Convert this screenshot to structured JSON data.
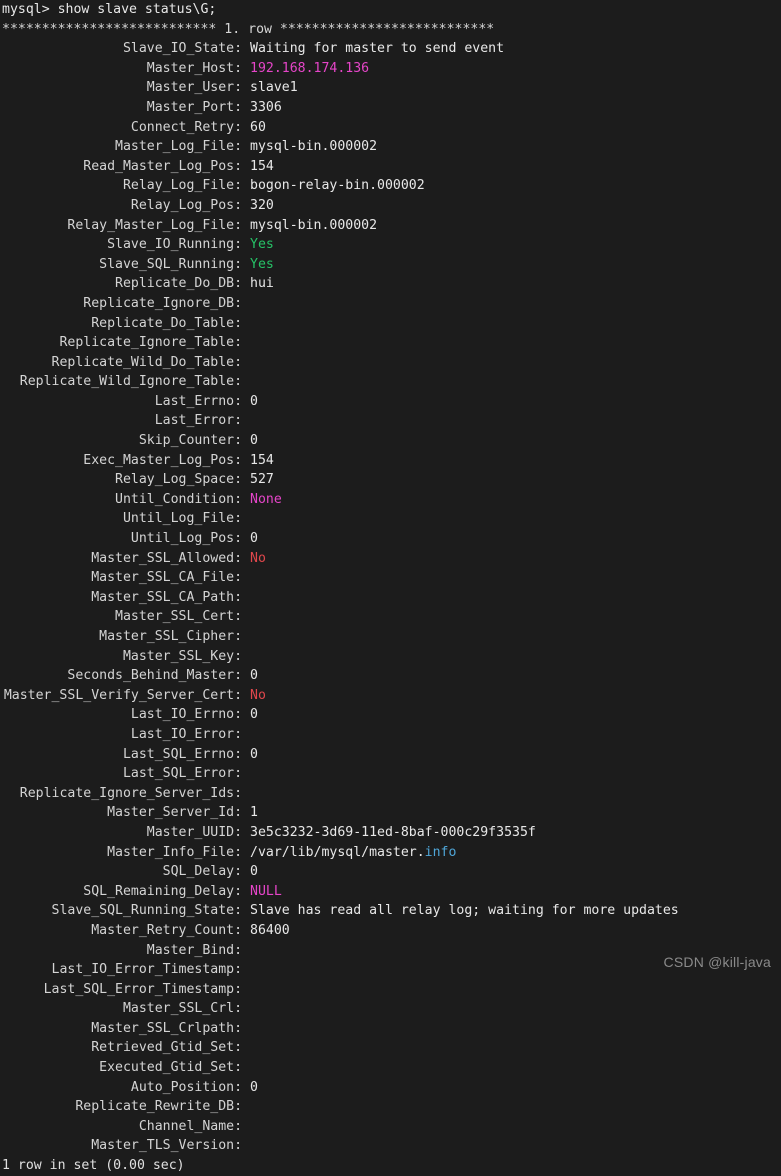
{
  "terminal": {
    "prompt_line": "mysql> show slave status\\G;",
    "row_separator": "*************************** 1. row ***************************",
    "footer_line": "1 row in set (0.00 sec)",
    "watermark": "CSDN @kill-java",
    "colors": {
      "background": "#1c1c1c",
      "foreground": "#e8e8e8",
      "label": "#d4d4d4",
      "green": "#26c166",
      "magenta": "#e545c8",
      "red": "#e0474c",
      "blue": "#4fa6d8",
      "watermark": "#8a8a8a"
    },
    "fields": [
      {
        "label": "Slave_IO_State",
        "value": "Waiting for master to send event",
        "color": "default"
      },
      {
        "label": "Master_Host",
        "value": "192.168.174.136",
        "color": "magenta"
      },
      {
        "label": "Master_User",
        "value": "slave1",
        "color": "default"
      },
      {
        "label": "Master_Port",
        "value": "3306",
        "color": "default"
      },
      {
        "label": "Connect_Retry",
        "value": "60",
        "color": "default"
      },
      {
        "label": "Master_Log_File",
        "value": "mysql-bin.000002",
        "color": "default"
      },
      {
        "label": "Read_Master_Log_Pos",
        "value": "154",
        "color": "default"
      },
      {
        "label": "Relay_Log_File",
        "value": "bogon-relay-bin.000002",
        "color": "default"
      },
      {
        "label": "Relay_Log_Pos",
        "value": "320",
        "color": "default"
      },
      {
        "label": "Relay_Master_Log_File",
        "value": "mysql-bin.000002",
        "color": "default"
      },
      {
        "label": "Slave_IO_Running",
        "value": "Yes",
        "color": "green"
      },
      {
        "label": "Slave_SQL_Running",
        "value": "Yes",
        "color": "green"
      },
      {
        "label": "Replicate_Do_DB",
        "value": "hui",
        "color": "default"
      },
      {
        "label": "Replicate_Ignore_DB",
        "value": "",
        "color": "default"
      },
      {
        "label": "Replicate_Do_Table",
        "value": "",
        "color": "default"
      },
      {
        "label": "Replicate_Ignore_Table",
        "value": "",
        "color": "default"
      },
      {
        "label": "Replicate_Wild_Do_Table",
        "value": "",
        "color": "default"
      },
      {
        "label": "Replicate_Wild_Ignore_Table",
        "value": "",
        "color": "default"
      },
      {
        "label": "Last_Errno",
        "value": "0",
        "color": "default"
      },
      {
        "label": "Last_Error",
        "value": "",
        "color": "default"
      },
      {
        "label": "Skip_Counter",
        "value": "0",
        "color": "default"
      },
      {
        "label": "Exec_Master_Log_Pos",
        "value": "154",
        "color": "default"
      },
      {
        "label": "Relay_Log_Space",
        "value": "527",
        "color": "default"
      },
      {
        "label": "Until_Condition",
        "value": "None",
        "color": "magenta"
      },
      {
        "label": "Until_Log_File",
        "value": "",
        "color": "default"
      },
      {
        "label": "Until_Log_Pos",
        "value": "0",
        "color": "default"
      },
      {
        "label": "Master_SSL_Allowed",
        "value": "No",
        "color": "red"
      },
      {
        "label": "Master_SSL_CA_File",
        "value": "",
        "color": "default"
      },
      {
        "label": "Master_SSL_CA_Path",
        "value": "",
        "color": "default"
      },
      {
        "label": "Master_SSL_Cert",
        "value": "",
        "color": "default"
      },
      {
        "label": "Master_SSL_Cipher",
        "value": "",
        "color": "default"
      },
      {
        "label": "Master_SSL_Key",
        "value": "",
        "color": "default"
      },
      {
        "label": "Seconds_Behind_Master",
        "value": "0",
        "color": "default"
      },
      {
        "label": "Master_SSL_Verify_Server_Cert",
        "value": "No",
        "color": "red"
      },
      {
        "label": "Last_IO_Errno",
        "value": "0",
        "color": "default"
      },
      {
        "label": "Last_IO_Error",
        "value": "",
        "color": "default"
      },
      {
        "label": "Last_SQL_Errno",
        "value": "0",
        "color": "default"
      },
      {
        "label": "Last_SQL_Error",
        "value": "",
        "color": "default"
      },
      {
        "label": "Replicate_Ignore_Server_Ids",
        "value": "",
        "color": "default"
      },
      {
        "label": "Master_Server_Id",
        "value": "1",
        "color": "default"
      },
      {
        "label": "Master_UUID",
        "value": "3e5c3232-3d69-11ed-8baf-000c29f3535f",
        "color": "default"
      },
      {
        "label": "Master_Info_File",
        "value": "/var/lib/mysql/master.info",
        "color": "path",
        "path_prefix": "/var/lib/mysql/master.",
        "path_suffix": "info"
      },
      {
        "label": "SQL_Delay",
        "value": "0",
        "color": "default"
      },
      {
        "label": "SQL_Remaining_Delay",
        "value": "NULL",
        "color": "magenta"
      },
      {
        "label": "Slave_SQL_Running_State",
        "value": "Slave has read all relay log; waiting for more updates",
        "color": "default"
      },
      {
        "label": "Master_Retry_Count",
        "value": "86400",
        "color": "default"
      },
      {
        "label": "Master_Bind",
        "value": "",
        "color": "default"
      },
      {
        "label": "Last_IO_Error_Timestamp",
        "value": "",
        "color": "default"
      },
      {
        "label": "Last_SQL_Error_Timestamp",
        "value": "",
        "color": "default"
      },
      {
        "label": "Master_SSL_Crl",
        "value": "",
        "color": "default"
      },
      {
        "label": "Master_SSL_Crlpath",
        "value": "",
        "color": "default"
      },
      {
        "label": "Retrieved_Gtid_Set",
        "value": "",
        "color": "default"
      },
      {
        "label": "Executed_Gtid_Set",
        "value": "",
        "color": "default"
      },
      {
        "label": "Auto_Position",
        "value": "0",
        "color": "default"
      },
      {
        "label": "Replicate_Rewrite_DB",
        "value": "",
        "color": "default"
      },
      {
        "label": "Channel_Name",
        "value": "",
        "color": "default"
      },
      {
        "label": "Master_TLS_Version",
        "value": "",
        "color": "default"
      }
    ]
  }
}
